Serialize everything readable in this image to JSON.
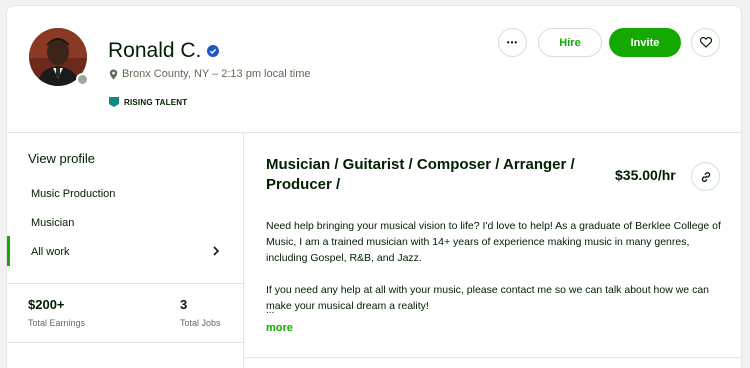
{
  "profile": {
    "name": "Ronald C.",
    "location": "Bronx County, NY – 2:13 pm local time",
    "badge": "RISING TALENT"
  },
  "actions": {
    "more": "•••",
    "hire": "Hire",
    "invite": "Invite"
  },
  "sidebar": {
    "view_profile": "View profile",
    "items": [
      {
        "label": "Music Production"
      },
      {
        "label": "Musician"
      },
      {
        "label": "All work"
      }
    ],
    "stats": [
      {
        "value": "$200+",
        "label": "Total Earnings"
      },
      {
        "value": "3",
        "label": "Total Jobs"
      }
    ]
  },
  "main": {
    "title": "Musician / Guitarist / Composer / Arranger / Producer /",
    "rate": "$35.00/hr",
    "description": [
      "Need help bringing your musical vision to life? I'd love to help! As a graduate of Berklee College of Music, I am a trained musician with 14+ years of experience making music in many genres, including Gospel, R&B, and Jazz.",
      "If you need any help at all with your music, please contact me so we can talk about how we can make your musical dream a reality!"
    ],
    "ellipsis": "...",
    "more": "more"
  },
  "colors": {
    "accent": "#14a800",
    "text": "#001e00",
    "muted": "#5e6d55",
    "verified": "#108a00"
  },
  "icons": [
    "verified-badge-icon",
    "location-pin-icon",
    "rising-talent-icon",
    "more-options-icon",
    "heart-icon",
    "chevron-right-icon",
    "link-icon"
  ]
}
